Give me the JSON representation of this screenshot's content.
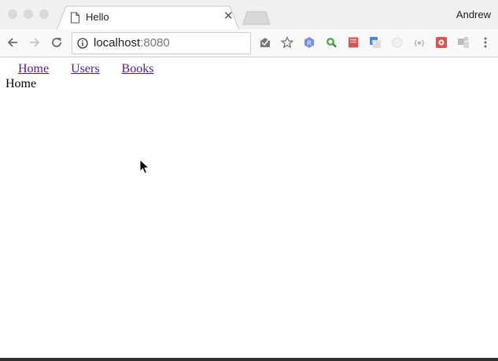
{
  "browser": {
    "tab": {
      "title": "Hello"
    },
    "profile_name": "Andrew",
    "address_bar": {
      "host": "localhost",
      "port": ":8080"
    },
    "extensions": [
      "inbox-icon",
      "bookmark-star-icon",
      "extension-r-icon",
      "extension-search-icon",
      "extension-book-icon",
      "google-translate-icon",
      "extension-circle-icon",
      "json-viewer-icon",
      "extension-red-icon",
      "extension-puzzle-icon"
    ]
  },
  "page": {
    "nav": [
      {
        "label": "Home"
      },
      {
        "label": "Users"
      },
      {
        "label": "Books"
      }
    ],
    "heading": "Home"
  },
  "colors": {
    "visited_link": "#551a8b",
    "chrome_bg": "#f0f0f0",
    "toolbar_bg": "#f8f8f8"
  }
}
